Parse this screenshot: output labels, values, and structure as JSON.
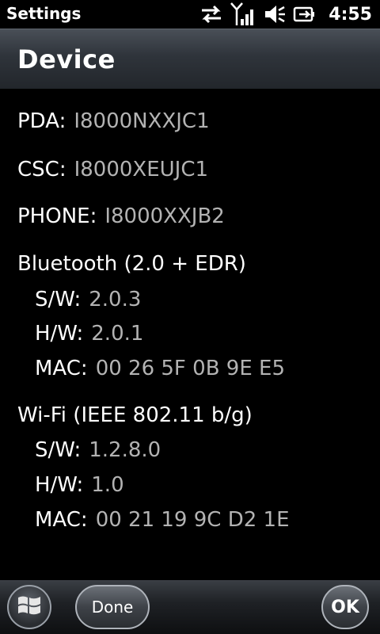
{
  "status_bar": {
    "app_title": "Settings",
    "time": "4:55",
    "icons": [
      "sync-arrows-icon",
      "signal-strength-icon",
      "volume-icon",
      "battery-charging-icon"
    ]
  },
  "header": {
    "title": "Device"
  },
  "info": {
    "pda": {
      "label": "PDA:",
      "value": "I8000NXXJC1"
    },
    "csc": {
      "label": "CSC:",
      "value": "I8000XEUJC1"
    },
    "phone": {
      "label": "PHONE:",
      "value": "I8000XXJB2"
    },
    "bluetooth": {
      "heading": "Bluetooth (2.0 + EDR)",
      "sw": {
        "label": "S/W:",
        "value": "2.0.3"
      },
      "hw": {
        "label": "H/W:",
        "value": "2.0.1"
      },
      "mac": {
        "label": "MAC:",
        "value": "00 26 5F 0B 9E E5"
      }
    },
    "wifi": {
      "heading": "Wi-Fi (IEEE 802.11 b/g)",
      "sw": {
        "label": "S/W:",
        "value": "1.2.8.0"
      },
      "hw": {
        "label": "H/W:",
        "value": "1.0"
      },
      "mac": {
        "label": "MAC:",
        "value": "00 21 19 9C D2 1E"
      }
    }
  },
  "bottom_bar": {
    "done_label": "Done",
    "ok_label": "OK",
    "start_icon": "windows-start-icon"
  }
}
